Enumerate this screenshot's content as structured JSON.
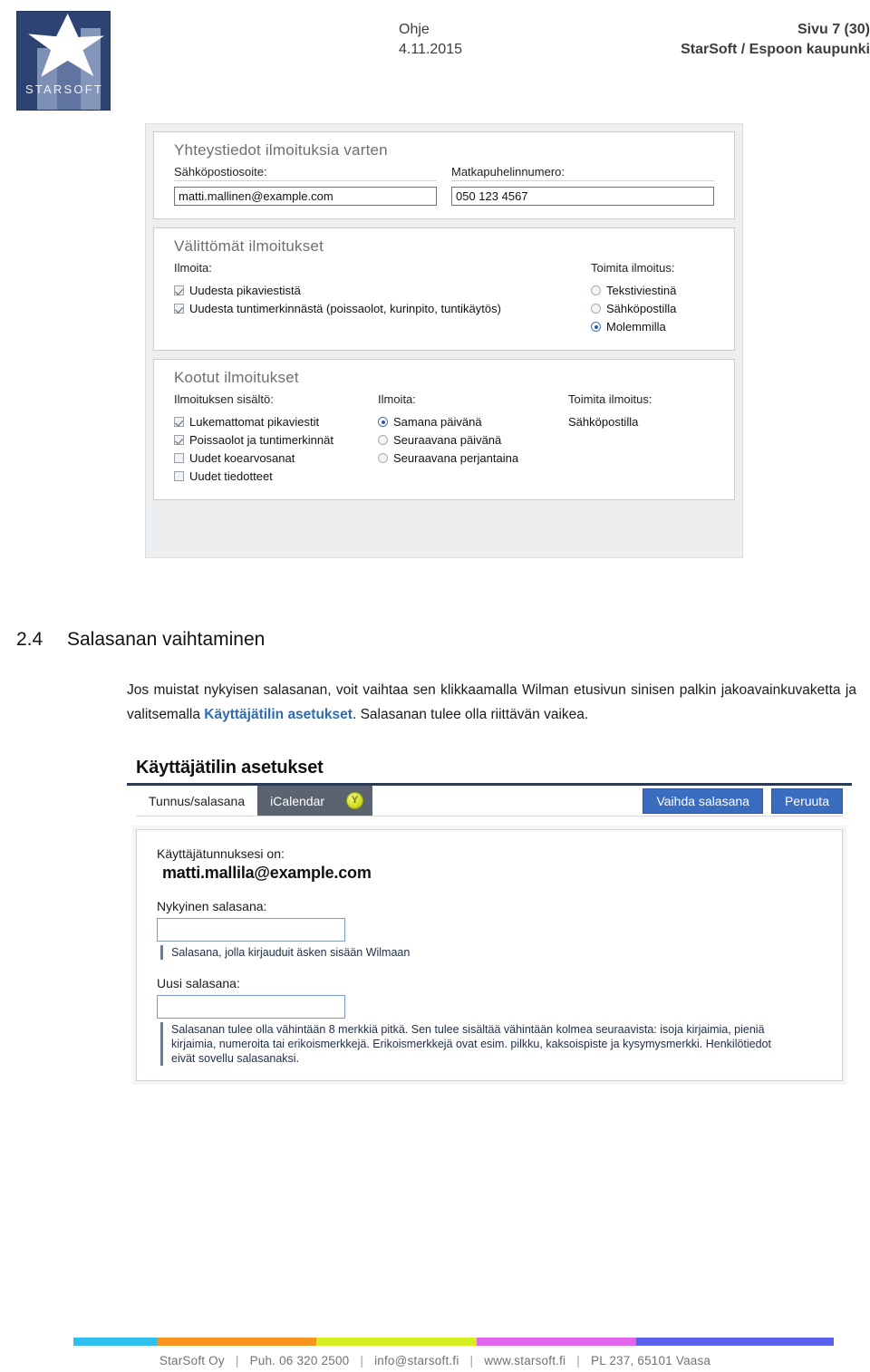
{
  "header": {
    "logo_wordmark": "STARSOFT",
    "logo_alt": "starsoft-logo",
    "middle_line1": "Ohje",
    "middle_line2": "4.11.2015",
    "right_line1": "Sivu 7 (30)",
    "right_line2": "StarSoft / Espoon kaupunki"
  },
  "screenshot_notifications": {
    "contact_panel": {
      "title": "Yhteystiedot ilmoituksia varten",
      "email_label": "Sähköpostiosoite:",
      "email_value": "matti.mallinen@example.com",
      "phone_label": "Matkapuhelinnumero:",
      "phone_value": "050 123 4567"
    },
    "immediate_panel": {
      "title": "Välittömät ilmoitukset",
      "notify_header": "Ilmoita:",
      "deliver_header": "Toimita ilmoitus:",
      "checkboxes": [
        {
          "label": "Uudesta pikaviestistä",
          "checked": true
        },
        {
          "label": "Uudesta tuntimerkinnästä (poissaolot, kurinpito, tuntikäytös)",
          "checked": true
        }
      ],
      "radios": [
        {
          "label": "Tekstiviestinä",
          "selected": false
        },
        {
          "label": "Sähköpostilla",
          "selected": false
        },
        {
          "label": "Molemmilla",
          "selected": true
        }
      ]
    },
    "digest_panel": {
      "title": "Kootut ilmoitukset",
      "content_header": "Ilmoituksen sisältö:",
      "notify_header": "Ilmoita:",
      "deliver_header": "Toimita ilmoitus:",
      "checkboxes": [
        {
          "label": "Lukemattomat pikaviestit",
          "checked": true
        },
        {
          "label": "Poissaolot ja tuntimerkinnät",
          "checked": true
        },
        {
          "label": "Uudet koearvosanat",
          "checked": false
        },
        {
          "label": "Uudet tiedotteet",
          "checked": false
        }
      ],
      "radios": [
        {
          "label": "Samana päivänä",
          "selected": true
        },
        {
          "label": "Seuraavana päivänä",
          "selected": false
        },
        {
          "label": "Seuraavana perjantaina",
          "selected": false
        }
      ],
      "deliver_value": "Sähköpostilla"
    }
  },
  "section": {
    "number": "2.4",
    "heading": "Salasanan vaihtaminen",
    "paragraph_before": "Jos muistat nykyisen salasanan, voit vaihtaa sen klikkaamalla Wilman etusivun sinisen palkin jakoavainkuvaketta ja valitsemalla ",
    "paragraph_link": "Käyttäjätilin asetukset",
    "paragraph_after": ". Salasanan tulee olla riittävän vaikea."
  },
  "screenshot_account": {
    "title": "Käyttäjätilin asetukset",
    "tabs": [
      {
        "label": "Tunnus/salasana",
        "active": true
      },
      {
        "label": "iCalendar",
        "active": false
      }
    ],
    "badge_label": "Y",
    "buttons": [
      {
        "label": "Vaihda salasana"
      },
      {
        "label": "Peruuta"
      }
    ],
    "username_label": "Käyttäjätunnuksesi on:",
    "username_value": "matti.mallila@example.com",
    "current_password_label": "Nykyinen salasana:",
    "current_password_value": "",
    "current_password_hint": "Salasana, jolla kirjauduit äsken sisään Wilmaan",
    "new_password_label": "Uusi salasana:",
    "new_password_value": "",
    "new_password_hint": "Salasanan tulee olla vähintään 8 merkkiä pitkä. Sen tulee sisältää vähintään kolmea seuraavista: isoja kirjaimia, pieniä kirjaimia, numeroita tai erikoismerkkejä. Erikoismerkkejä ovat esim. pilkku, kaksoispiste ja kysymysmerkki. Henkilötiedot eivät sovellu salasanaksi."
  },
  "footer": {
    "company": "StarSoft Oy",
    "phone": "Puh. 06 320 2500",
    "email": "info@starsoft.fi",
    "website": "www.starsoft.fi",
    "address": "PL 237, 65101 Vaasa",
    "separator": "|",
    "bar_colors": [
      "#2ec0ee",
      "#f7941e",
      "#d4f021",
      "#e264ec",
      "#5b61ef"
    ]
  }
}
